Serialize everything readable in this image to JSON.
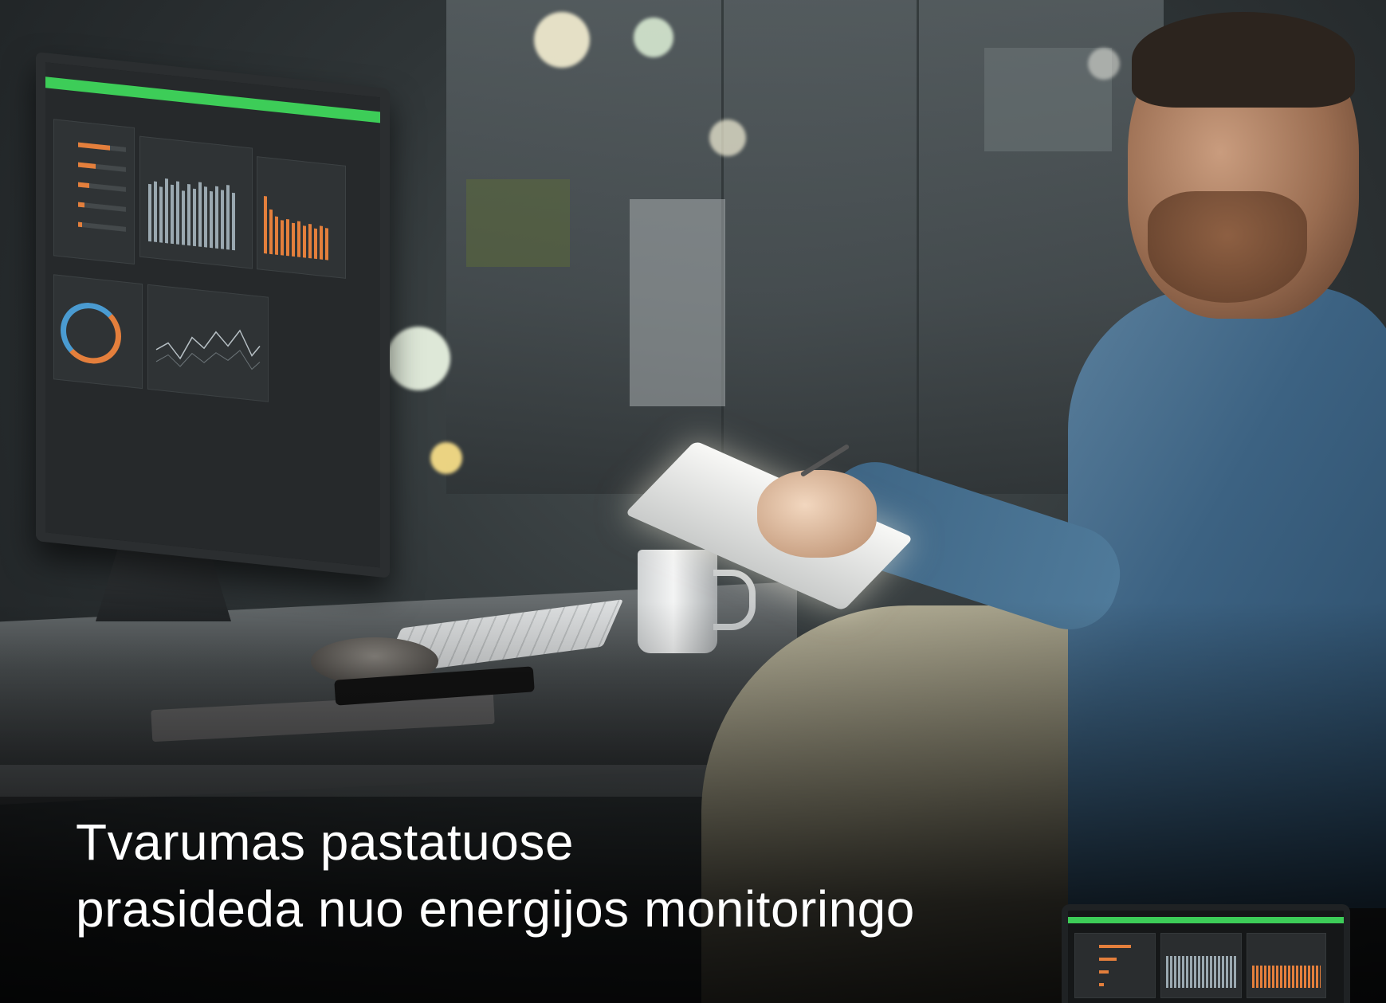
{
  "headline": {
    "line1": "Tvarumas pastatuose",
    "line2": "prasideda nuo energijos monitoringo"
  },
  "colors": {
    "brand_green": "#3dcd58",
    "accent_orange": "#e47f3c",
    "accent_blue": "#4a9bd1",
    "text": "#ffffff"
  }
}
